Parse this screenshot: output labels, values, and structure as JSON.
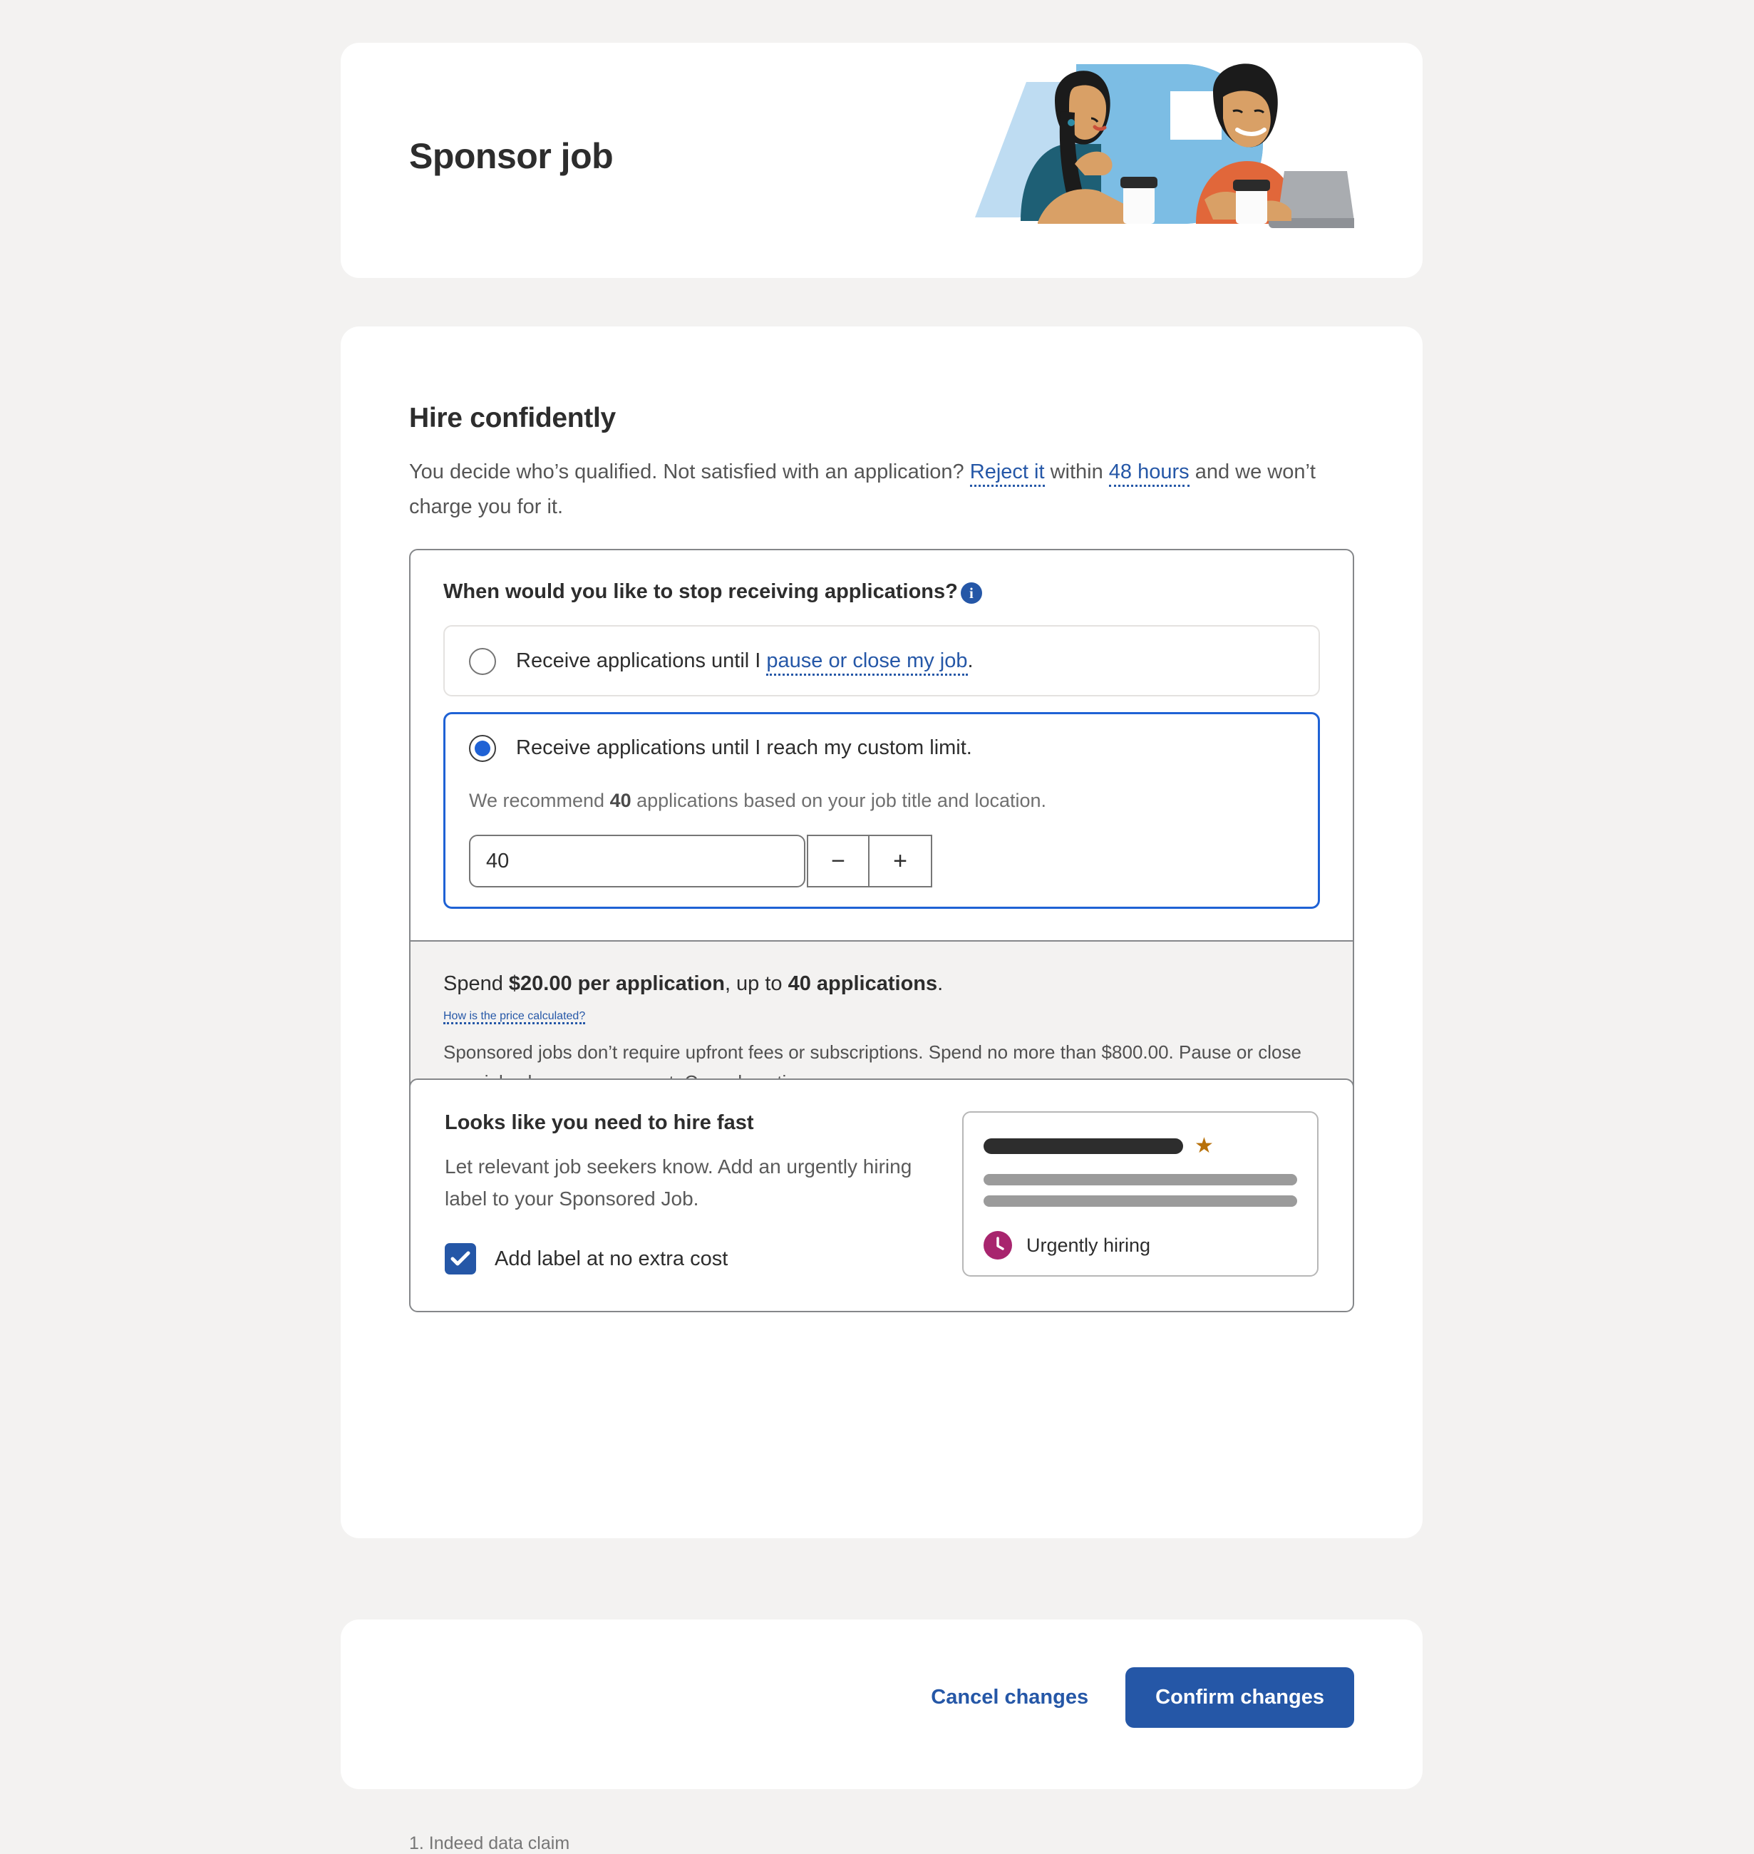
{
  "header": {
    "title": "Sponsor job",
    "illustration_name": "two-coworkers-illustration"
  },
  "hire_confidently": {
    "title": "Hire confidently",
    "desc_part1": "You decide who’s qualified. Not satisfied with an application? ",
    "link_reject": "Reject it",
    "desc_part2": " within ",
    "link_hours": "48 hours",
    "desc_part3": " and we won’t charge you for it."
  },
  "question": {
    "label": "When would you like to stop receiving applications?",
    "info_icon_glyph": "i",
    "options": [
      {
        "id": "until-pause-or-close",
        "selected": false,
        "text_before": "Receive applications until I ",
        "link": "pause or close my job",
        "text_after": "."
      },
      {
        "id": "custom-limit",
        "selected": true,
        "text": "Receive applications until I reach my custom limit."
      }
    ],
    "recommend_prefix": "We recommend ",
    "recommend_value": "40",
    "recommend_suffix": " applications based on your job title and location.",
    "limit_value": "40",
    "limit_placeholder": "40",
    "decrement_label": "−",
    "increment_label": "+"
  },
  "price": {
    "line_a": "Spend ",
    "amount": "$20.00 per application",
    "line_b": ", up to ",
    "cap": "40 applications",
    "line_c": ".",
    "link": "How is the price calculated?",
    "note": "Sponsored jobs don’t require upfront fees or subscriptions. Spend no more than $800.00. Pause or close your job whenever you want. Cancel anytime."
  },
  "hire_fast": {
    "title": "Looks like you need to hire fast",
    "desc": "Let relevant job seekers know. Add an urgently hiring label to your Sponsored Job.",
    "checkbox_label": "Add label at no extra cost",
    "checkbox_checked": true,
    "preview": {
      "star_glyph": "★",
      "urgent_label": "Urgently hiring",
      "clock_icon_name": "clock-icon"
    }
  },
  "footnote": "1. Indeed data claim",
  "footer": {
    "cancel_label": "Cancel changes",
    "confirm_label": "Confirm changes"
  },
  "colors": {
    "brand_blue": "#2557a7",
    "focus_blue": "#1f62d5",
    "page_bg": "#f3f2f1",
    "urgent_magenta": "#a8256e",
    "star_gold": "#b8710a"
  }
}
